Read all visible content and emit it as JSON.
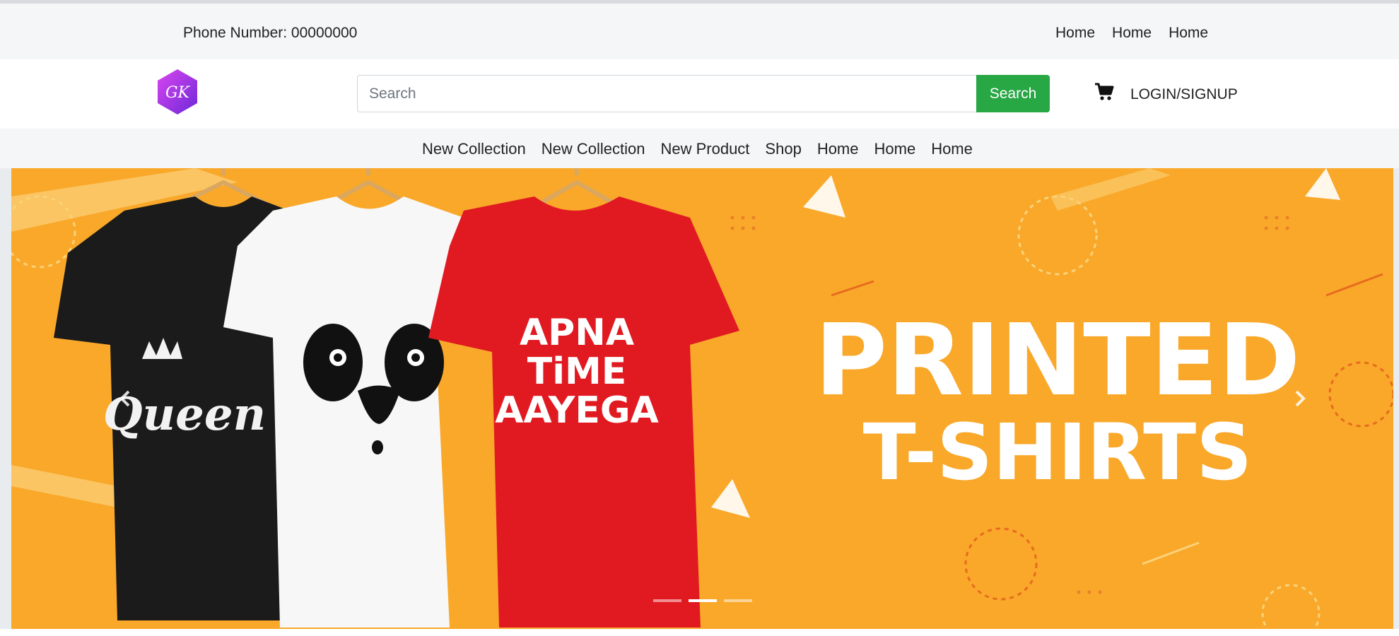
{
  "topbar": {
    "phone": "Phone Number: 00000000",
    "links": [
      "Home",
      "Home",
      "Home"
    ]
  },
  "header": {
    "logo_text": "GK",
    "search_placeholder": "Search",
    "search_value": "",
    "search_button": "Search",
    "cart_icon": "shopping-cart-icon",
    "login_label": "LOGIN/SIGNUP"
  },
  "nav": {
    "items": [
      "New Collection",
      "New Collection",
      "New Product",
      "Shop",
      "Home",
      "Home",
      "Home"
    ]
  },
  "carousel": {
    "banner_title": "PRINTED",
    "banner_subtitle": "T-SHIRTS",
    "shirt_black_text": "Queen",
    "shirt_red_text": [
      "APNA",
      "TiME",
      "AAYEGA"
    ],
    "prev_icon": "chevron-left-icon",
    "next_icon": "chevron-right-icon",
    "slide_count": 3,
    "active_slide": 2
  },
  "colors": {
    "accent": "#28a745",
    "banner_bg": "#f9a82a",
    "logo_gradient_start": "#d946ef",
    "logo_gradient_end": "#6d28d9"
  }
}
